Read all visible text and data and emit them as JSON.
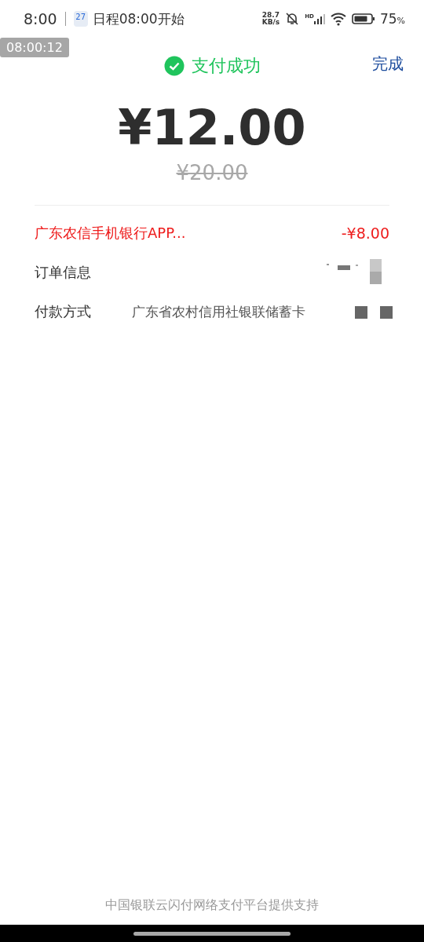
{
  "status_bar": {
    "time": "8:00",
    "calendar_day": "27",
    "notification": "日程08:00开始",
    "net_speed_value": "28.7",
    "net_speed_unit": "KB/s",
    "network_label": "HD",
    "battery_percent": "75",
    "percent_sign": "%"
  },
  "timer_badge": "08:00:12",
  "header": {
    "title": "支付成功",
    "done": "完成"
  },
  "amount": {
    "paid": "¥12.00",
    "original": "¥20.00"
  },
  "rows": [
    {
      "kind": "discount",
      "label": "广东农信手机银行APP...",
      "value": "-¥8.00"
    },
    {
      "kind": "redacted",
      "label": "订单信息"
    },
    {
      "kind": "method",
      "label": "付款方式",
      "value": "广东省农村信用社银联储蓄卡"
    }
  ],
  "footer": "中国银联云闪付网络支付平台提供支持"
}
